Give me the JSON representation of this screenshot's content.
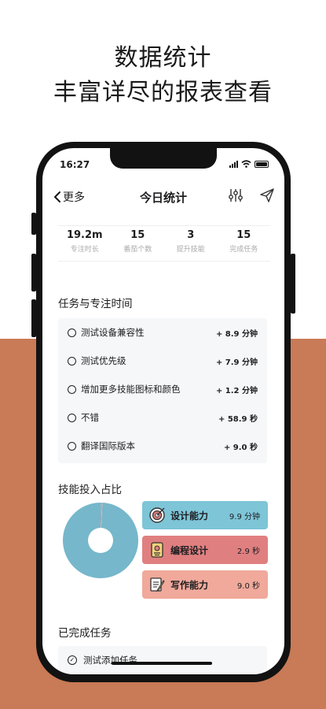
{
  "promo": {
    "line1": "数据统计",
    "line2": "丰富详尽的报表查看"
  },
  "status_bar": {
    "time": "16:27"
  },
  "nav": {
    "back_label": "更多",
    "title": "今日统计",
    "filter_icon": "sliders-icon",
    "share_icon": "send-icon"
  },
  "stats": [
    {
      "value": "19.2m",
      "label": "专注时长"
    },
    {
      "value": "15",
      "label": "番茄个数"
    },
    {
      "value": "3",
      "label": "提升技能"
    },
    {
      "value": "15",
      "label": "完成任务"
    }
  ],
  "tasks_section": {
    "title": "任务与专注时间",
    "items": [
      {
        "name": "测试设备兼容性",
        "time": "+ 8.9 分钟"
      },
      {
        "name": "测试优先级",
        "time": "+ 7.9 分钟"
      },
      {
        "name": "增加更多技能图标和颜色",
        "time": "+ 1.2 分钟"
      },
      {
        "name": "不错",
        "time": "+ 58.9 秒"
      },
      {
        "name": "翻译国际版本",
        "time": "+ 9.0 秒"
      }
    ]
  },
  "skills_section": {
    "title": "技能投入占比",
    "items": [
      {
        "name": "设计能力",
        "value": "9.9 分钟",
        "color": "#7ec5d8",
        "icon": "target-icon"
      },
      {
        "name": "编程设计",
        "value": "2.9 秒",
        "color": "#e07f80",
        "icon": "id-card-icon"
      },
      {
        "name": "写作能力",
        "value": "9.0 秒",
        "color": "#f0a99b",
        "icon": "writing-icon"
      }
    ],
    "pie_colors": [
      "#76b7cb",
      "#e07f80",
      "#f0a99b"
    ],
    "pie_fractions": [
      0.995,
      0.003,
      0.002
    ]
  },
  "done_section": {
    "title": "已完成任务",
    "items": [
      {
        "name": "测试添加任务"
      }
    ]
  },
  "colors": {
    "background_band": "#c97a56"
  }
}
